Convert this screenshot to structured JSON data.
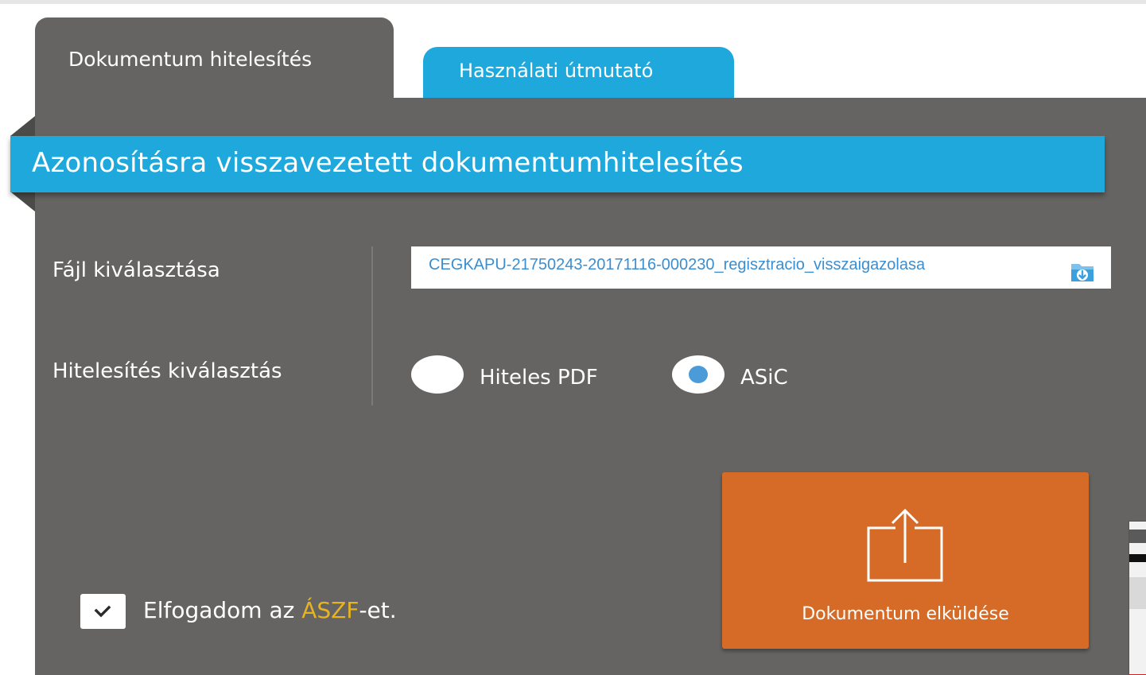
{
  "tabs": {
    "active_label": "Dokumentum hitelesítés",
    "help_label": "Használati útmutató"
  },
  "panel": {
    "title": "Azonosításra visszavezetett dokumentumhitelesítés",
    "file_label": "Fájl kiválasztása",
    "file_value": "CEGKAPU-21750243-20171116-000230_regisztracio_visszaigazolasa",
    "auth_label": "Hitelesítés kiválasztás",
    "options": [
      {
        "label": "Hiteles PDF",
        "selected": false
      },
      {
        "label": "ASiC",
        "selected": true
      }
    ]
  },
  "terms": {
    "checked": true,
    "prefix": "Elfogadom az ",
    "link": "ÁSZF",
    "suffix": "-et."
  },
  "submit": {
    "label": "Dokumentum elküldése",
    "icon": "upload-icon"
  },
  "colors": {
    "panel": "#656462",
    "accent_blue": "#1fa8dc",
    "button_orange": "#d56b26",
    "link_yellow": "#e8b321"
  }
}
